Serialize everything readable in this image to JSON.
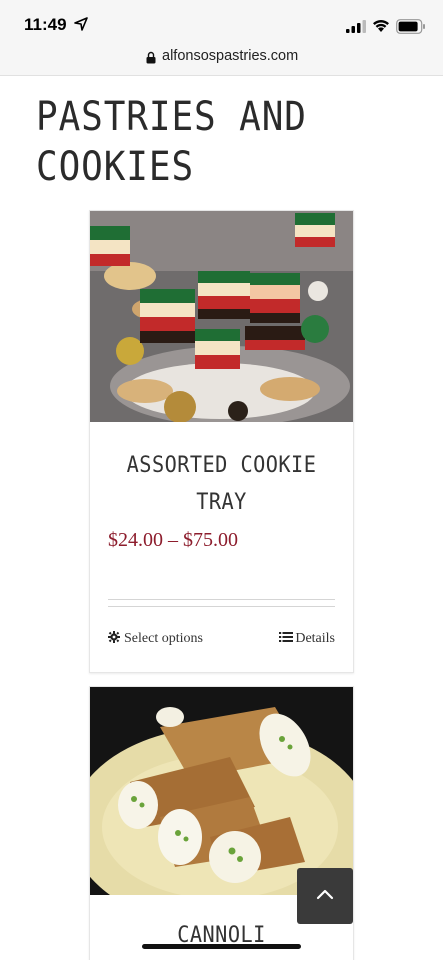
{
  "status_bar": {
    "time": "11:49",
    "icons": [
      "location-arrow-icon",
      "cellular-signal-icon",
      "wifi-icon",
      "battery-icon"
    ]
  },
  "browser": {
    "url": "alfonsospastries.com",
    "lock_icon": "lock-icon"
  },
  "page": {
    "title": "PASTRIES AND COOKIES"
  },
  "products": [
    {
      "name": "ASSORTED COOKIE TRAY",
      "price": "$24.00 – $75.00",
      "select_label": "Select options",
      "details_label": "Details",
      "image": "rainbow-cookie-tray-photo"
    },
    {
      "name": "CANNOLI",
      "image": "cannoli-plate-photo"
    }
  ],
  "controls": {
    "back_to_top_icon": "chevron-up-icon"
  },
  "colors": {
    "price": "#8d1d2d",
    "back_to_top_bg": "#3a3a3a",
    "browser_chrome": "#f6f6f6"
  }
}
